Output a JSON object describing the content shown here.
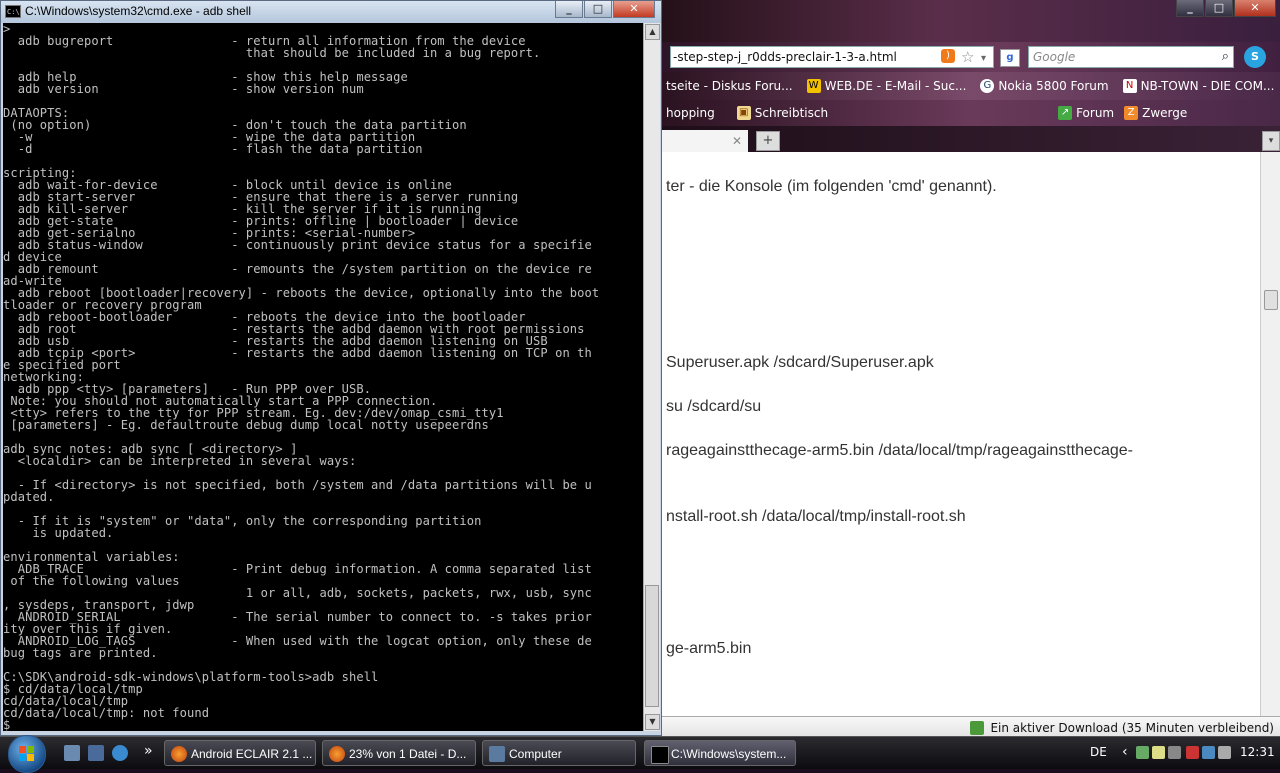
{
  "cmd": {
    "title": "C:\\Windows\\system32\\cmd.exe - adb  shell",
    "minimize": "_",
    "maximize": "□",
    "close": "✕",
    "lines": [
      ">",
      "  adb bugreport                - return all information from the device",
      "                                 that should be included in a bug report.",
      "",
      "  adb help                     - show this help message",
      "  adb version                  - show version num",
      "",
      "DATAOPTS:",
      " (no option)                   - don't touch the data partition",
      "  -w                           - wipe the data partition",
      "  -d                           - flash the data partition",
      "",
      "scripting:",
      "  adb wait-for-device          - block until device is online",
      "  adb start-server             - ensure that there is a server running",
      "  adb kill-server              - kill the server if it is running",
      "  adb get-state                - prints: offline | bootloader | device",
      "  adb get-serialno             - prints: <serial-number>",
      "  adb status-window            - continuously print device status for a specifie",
      "d device",
      "  adb remount                  - remounts the /system partition on the device re",
      "ad-write",
      "  adb reboot [bootloader|recovery] - reboots the device, optionally into the boot",
      "tloader or recovery program",
      "  adb reboot-bootloader        - reboots the device into the bootloader",
      "  adb root                     - restarts the adbd daemon with root permissions",
      "  adb usb                      - restarts the adbd daemon listening on USB",
      "  adb tcpip <port>             - restarts the adbd daemon listening on TCP on th",
      "e specified port",
      "networking:",
      "  adb ppp <tty> [parameters]   - Run PPP over USB.",
      " Note: you should not automatically start a PPP connection.",
      " <tty> refers to the tty for PPP stream. Eg. dev:/dev/omap_csmi_tty1",
      " [parameters] - Eg. defaultroute debug dump local notty usepeerdns",
      "",
      "adb sync notes: adb sync [ <directory> ]",
      "  <localdir> can be interpreted in several ways:",
      "",
      "  - If <directory> is not specified, both /system and /data partitions will be u",
      "pdated.",
      "",
      "  - If it is \"system\" or \"data\", only the corresponding partition",
      "    is updated.",
      "",
      "environmental variables:",
      "  ADB_TRACE                    - Print debug information. A comma separated list",
      " of the following values",
      "                                 1 or all, adb, sockets, packets, rwx, usb, sync",
      ", sysdeps, transport, jdwp",
      "  ANDROID_SERIAL               - The serial number to connect to. -s takes prior",
      "ity over this if given.",
      "  ANDROID_LOG_TAGS             - When used with the logcat option, only these de",
      "bug tags are printed.",
      "",
      "C:\\SDK\\android-sdk-windows\\platform-tools>adb shell",
      "$ cd/data/local/tmp",
      "cd/data/local/tmp",
      "cd/data/local/tmp: not found",
      "$ _"
    ]
  },
  "browser": {
    "url": "-step-step-j_r0dds-preclair-1-3-a.html",
    "search_placeholder": "Google",
    "bookmarks": [
      {
        "label": "tseite - Diskus Foru..."
      },
      {
        "label": "WEB.DE - E-Mail - Suc..."
      },
      {
        "label": "Nokia 5800 Forum"
      },
      {
        "label": "NB-TOWN - DIE COM..."
      }
    ],
    "bookmarks2": [
      {
        "label": "hopping"
      },
      {
        "label": "Schreibtisch"
      },
      {
        "label": "Forum"
      },
      {
        "label": "Zwerge"
      }
    ],
    "tab_close": "✕",
    "tab_new": "+",
    "tab_list": "▾",
    "content_lines": [
      "ter - die Konsole (im folgenden 'cmd' genannt).",
      "Superuser.apk /sdcard/Superuser.apk",
      "su /sdcard/su",
      "rageagainstthecage-arm5.bin /data/local/tmp/rageagainstthecage-",
      "nstall-root.sh /data/local/tmp/install-root.sh",
      "ge-arm5.bin"
    ],
    "status": "Ein aktiver Download (35 Minuten verbleibend)",
    "minimize": "_",
    "maximize": "□",
    "close": "✕"
  },
  "taskbar": {
    "buttons": [
      {
        "label": "Android ECLAIR 2.1 ..."
      },
      {
        "label": "23% von 1 Datei - D..."
      },
      {
        "label": "Computer"
      },
      {
        "label": "C:\\Windows\\system..."
      }
    ],
    "more": "»",
    "tray_lang": "DE",
    "tray_arrow": "‹",
    "clock": "12:31"
  }
}
